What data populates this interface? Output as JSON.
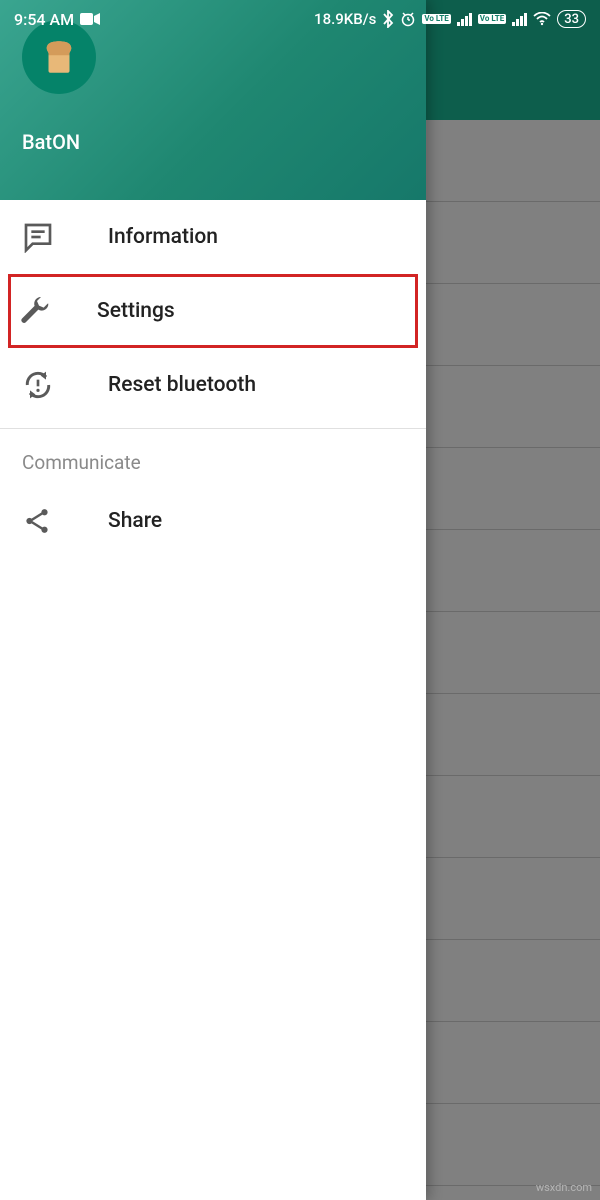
{
  "status_bar": {
    "time": "9:54 AM",
    "data_rate": "18.9KB/s",
    "battery_percent": "33",
    "volte_label": "Vo LTE"
  },
  "drawer": {
    "app_name": "BatON",
    "items": [
      {
        "label": "Information",
        "icon": "chat-icon"
      },
      {
        "label": "Settings",
        "icon": "wrench-icon"
      },
      {
        "label": "Reset bluetooth",
        "icon": "reset-icon"
      }
    ],
    "section_header": "Communicate",
    "share_label": "Share"
  },
  "watermark": "wsxdn.com"
}
